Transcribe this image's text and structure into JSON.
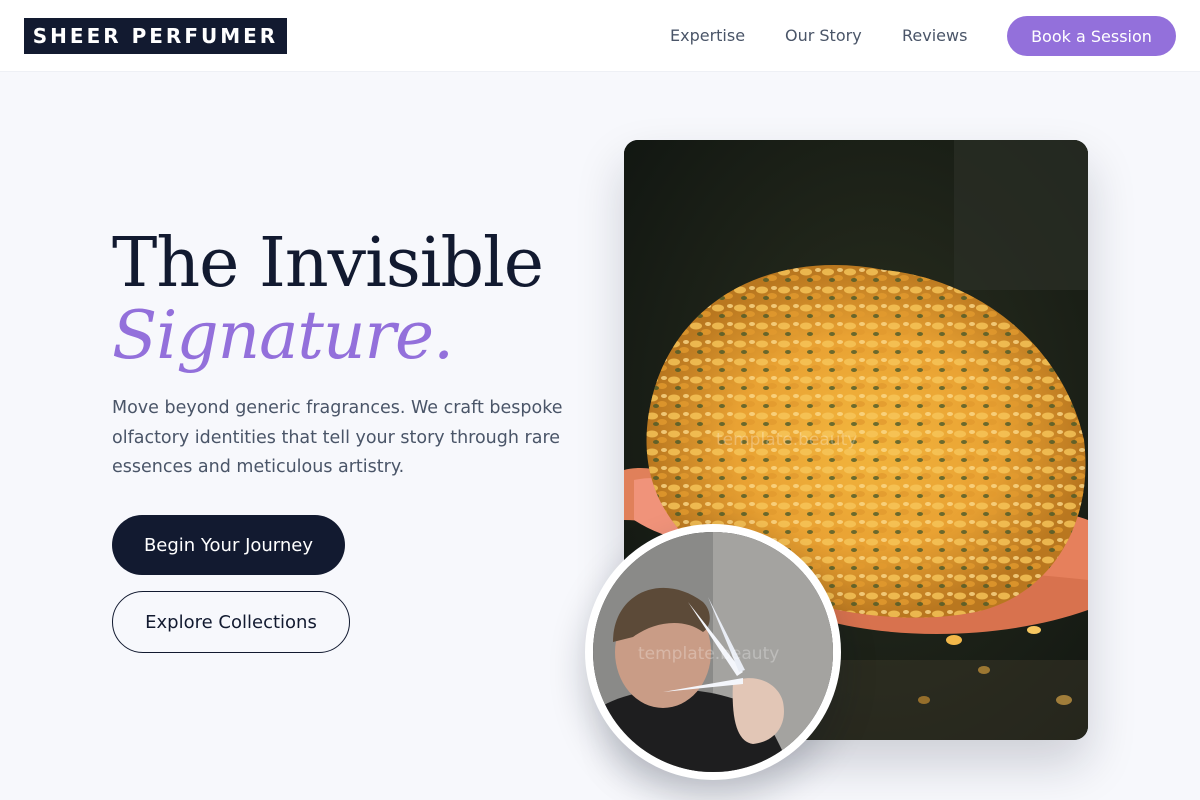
{
  "header": {
    "logo": "SHEER PERFUMER",
    "nav": {
      "expertise": "Expertise",
      "story": "Our Story",
      "reviews": "Reviews"
    },
    "cta": "Book a Session"
  },
  "hero": {
    "title_line1": "The Invisible",
    "title_line2": "Signature.",
    "description": "Move beyond generic fragrances. We craft bespoke olfactory identities that tell your story through rare essences and meticulous artistry.",
    "primary_button": "Begin Your Journey",
    "secondary_button": "Explore Collections"
  },
  "images": {
    "watermark": "template.beauty"
  },
  "colors": {
    "brand_dark": "#121a30",
    "accent_purple": "#9370db",
    "page_background": "#f7f8fc"
  }
}
